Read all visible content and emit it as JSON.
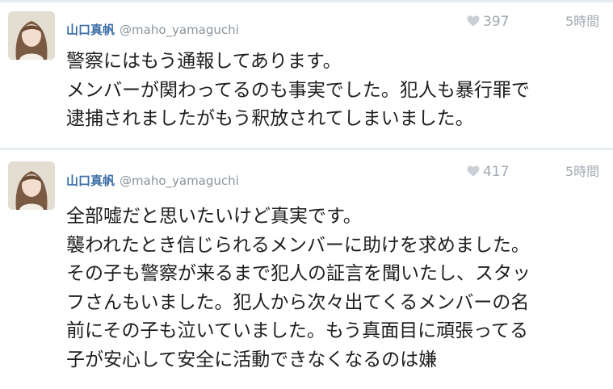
{
  "tweets": [
    {
      "name": "山口真帆",
      "handle": "@maho_yamaguchi",
      "likes": "397",
      "time": "5時間",
      "lines": [
        "警察にはもう通報してあります。",
        "メンバーが関わってるのも事実でした。犯人も暴行罪で",
        "逮捕されましたがもう釈放されてしまいました。"
      ]
    },
    {
      "name": "山口真帆",
      "handle": "@maho_yamaguchi",
      "likes": "417",
      "time": "5時間",
      "lines": [
        "全部嘘だと思いたいけど真実です。",
        "襲われたとき信じられるメンバーに助けを求めました。",
        "その子も警察が来るまで犯人の証言を聞いたし、スタッ",
        "フさんもいました。犯人から次々出てくるメンバーの名",
        "前にその子も泣いていました。もう真面目に頑張ってる",
        "子が安心して安全に活動できなくなるのは嫌"
      ]
    }
  ],
  "icons": {
    "like": "heart-icon"
  },
  "colors": {
    "name": "#3a6ea5",
    "muted": "#a2aab2",
    "divider": "#e6ecf0"
  }
}
